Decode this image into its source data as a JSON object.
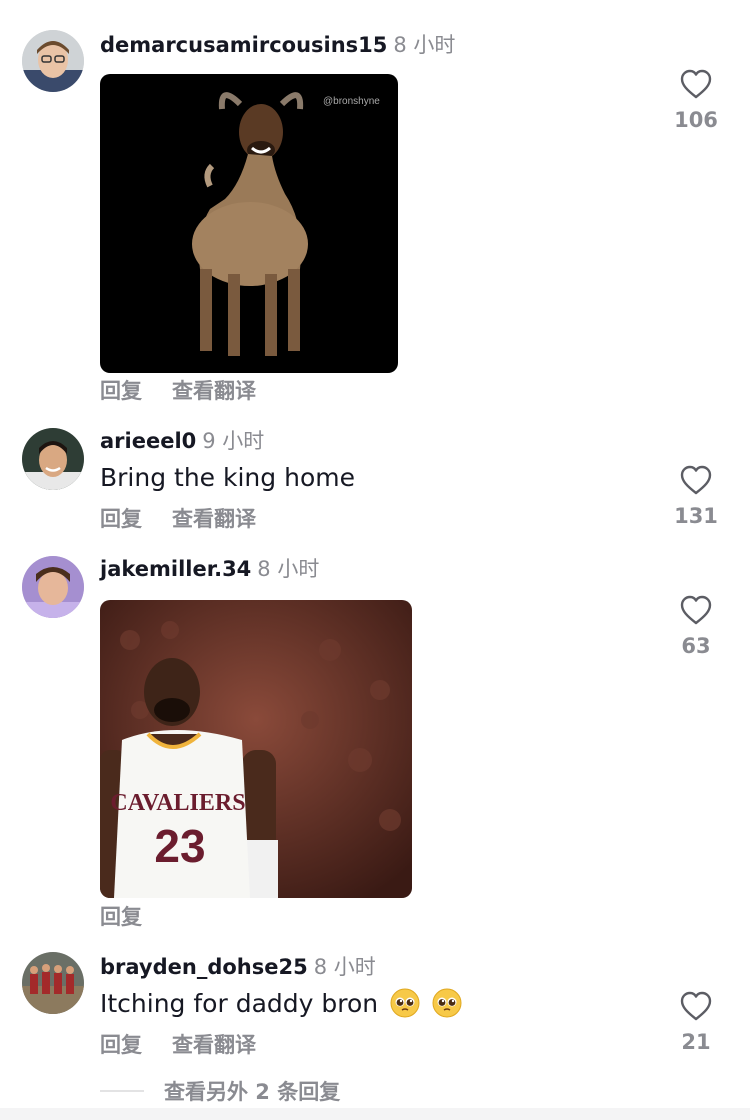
{
  "comments": [
    {
      "username": "demarcusamircousins15",
      "time": "8 小时",
      "reply_label": "回复",
      "translate_label": "查看翻译",
      "like_count": "106",
      "media": {
        "type": "gif",
        "watermark": "@bronshyne",
        "description_icon": "goat-gif"
      }
    },
    {
      "username": "arieeel0",
      "time": "9 小时",
      "text": "Bring the king home",
      "reply_label": "回复",
      "translate_label": "查看翻译",
      "like_count": "131"
    },
    {
      "username": "jakemiller.34",
      "time": "8 小时",
      "reply_label": "回复",
      "like_count": "63",
      "media": {
        "type": "gif",
        "jersey_text": "CAVALIERS",
        "jersey_number": "23"
      }
    },
    {
      "username": "brayden_dohse25",
      "time": "8 小时",
      "text": "Itching for daddy bron",
      "emojis": [
        "pleading-face",
        "pleading-face"
      ],
      "reply_label": "回复",
      "translate_label": "查看翻译",
      "like_count": "21"
    }
  ],
  "more_replies": "查看另外 2 条回复",
  "colors": {
    "text": "#161823",
    "secondary": "#8a8b91",
    "background": "#ffffff"
  }
}
